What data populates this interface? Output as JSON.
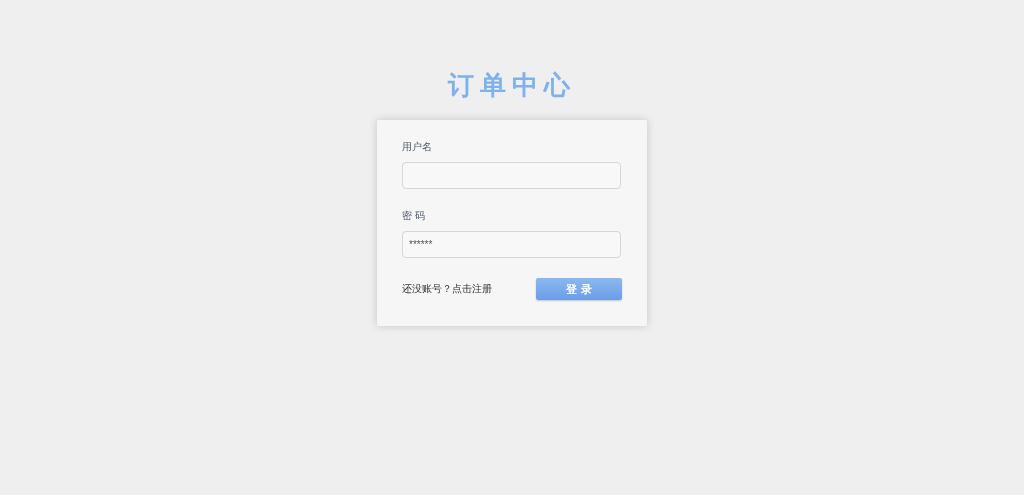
{
  "title": "订单中心",
  "form": {
    "fields": [
      {
        "label": "用户名"
      },
      {
        "label": "密 码",
        "value": "******"
      }
    ],
    "register_link": "还没账号？点击注册",
    "login_button": "登 录"
  }
}
